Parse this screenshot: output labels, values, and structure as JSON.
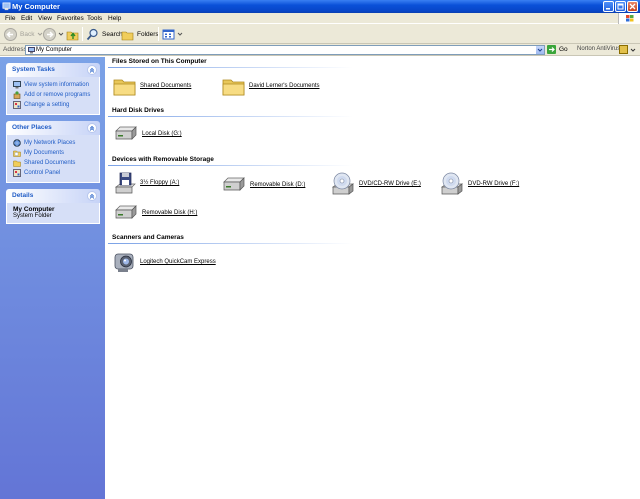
{
  "window": {
    "title": "My Computer"
  },
  "menu": [
    "File",
    "Edit",
    "View",
    "Favorites",
    "Tools",
    "Help"
  ],
  "toolbar": {
    "back": "Back",
    "search": "Search",
    "folders": "Folders"
  },
  "address": {
    "label": "Address",
    "value": "My Computer",
    "go": "Go",
    "norton": "Norton AntiVirus"
  },
  "sidebar": {
    "system_tasks": {
      "title": "System Tasks",
      "items": [
        "View system information",
        "Add or remove programs",
        "Change a setting"
      ]
    },
    "other_places": {
      "title": "Other Places",
      "items": [
        "My Network Places",
        "My Documents",
        "Shared Documents",
        "Control Panel"
      ]
    },
    "details": {
      "title": "Details",
      "name": "My Computer",
      "subtitle": "System Folder"
    }
  },
  "groups": {
    "files": {
      "title": "Files Stored on This Computer",
      "items": [
        "Shared Documents",
        "David Lerner's Documents"
      ]
    },
    "hdd": {
      "title": "Hard Disk Drives",
      "items": [
        "Local Disk (G:)"
      ]
    },
    "removable": {
      "title": "Devices with Removable Storage",
      "items": [
        "3½ Floppy (A:)",
        "Removable Disk (D:)",
        "DVD/CD-RW Drive (E:)",
        "DVD-RW Drive (F:)",
        "Removable Disk (H:)"
      ]
    },
    "scanners": {
      "title": "Scanners and Cameras",
      "items": [
        "Logitech QuickCam Express"
      ]
    }
  }
}
